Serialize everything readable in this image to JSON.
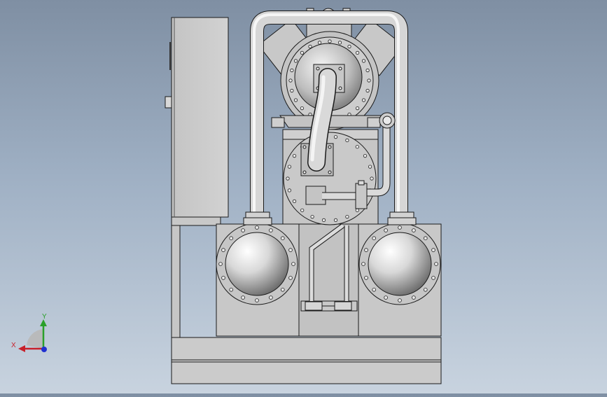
{
  "viewport": {
    "title": "",
    "background_top": "#7f8fa3",
    "background_bottom": "#c8d3df"
  },
  "triad": {
    "x_label": "X",
    "y_label": "Y",
    "x_color": "#c8202a",
    "y_color": "#2aa02a",
    "z_color": "#2030d0"
  },
  "model": {
    "body_color": "#c9c9c9",
    "line_color": "#1a1a1a",
    "pipe_color": "#d6d6d6"
  }
}
